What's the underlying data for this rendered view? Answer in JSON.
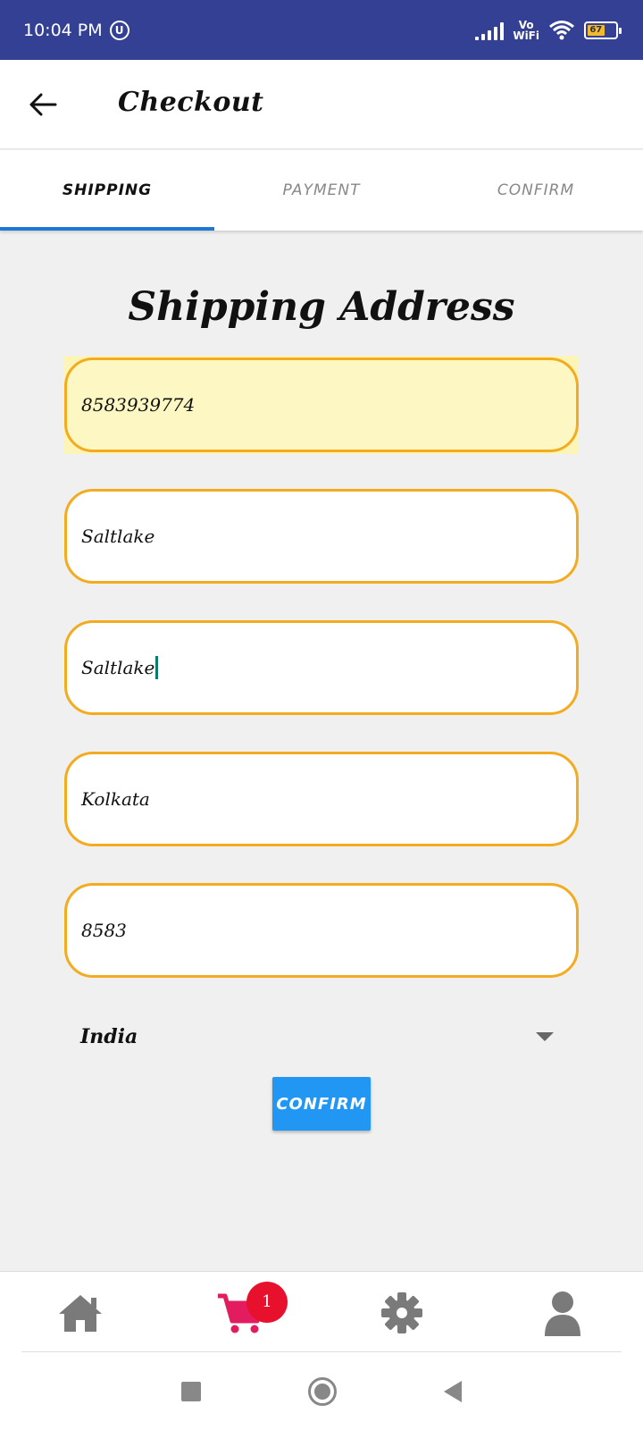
{
  "status_bar": {
    "time": "10:04 PM",
    "network_label": "Vo\nWiFi",
    "battery_level": "67"
  },
  "app_bar": {
    "title": "Checkout"
  },
  "tabs": [
    {
      "label": "SHIPPING",
      "active": true
    },
    {
      "label": "PAYMENT",
      "active": false
    },
    {
      "label": "CONFIRM",
      "active": false
    }
  ],
  "form": {
    "title": "Shipping Address",
    "fields": [
      {
        "value": "8583939774"
      },
      {
        "value": "Saltlake"
      },
      {
        "value": "Saltlake"
      },
      {
        "value": "Kolkata"
      },
      {
        "value": "8583"
      }
    ],
    "country": "India",
    "confirm_label": "CONFIRM"
  },
  "bottom_nav": {
    "cart_count": "1",
    "items": [
      "home-icon",
      "cart-icon",
      "gear-icon",
      "user-icon"
    ]
  },
  "colors": {
    "status_bar": "#344093",
    "field_border": "#f3ab1f",
    "autofill": "#fdf8c3",
    "tab_indicator": "#1e78d6",
    "confirm_button": "#2196f3",
    "cart": "#e31c5f",
    "badge": "#e8112d"
  }
}
